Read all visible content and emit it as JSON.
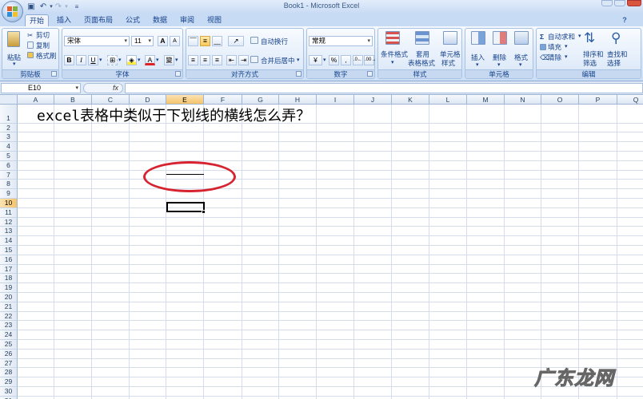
{
  "window": {
    "title": "Book1 - Microsoft Excel"
  },
  "colors": {
    "accent": "#15428b",
    "selected_header": "#f5c36b",
    "annotation": "#d7232f"
  },
  "tabs": [
    "开始",
    "插入",
    "页面布局",
    "公式",
    "数据",
    "审阅",
    "视图"
  ],
  "ribbon": {
    "clipboard": {
      "paste": "粘贴",
      "cut": "剪切",
      "copy": "复制",
      "format_painter": "格式刷",
      "label": "剪贴板"
    },
    "font": {
      "name": "宋体",
      "size": "11",
      "grow": "A",
      "shrink": "A",
      "bold": "B",
      "italic": "I",
      "underline": "U",
      "color": "A",
      "wen": "變",
      "label": "字体"
    },
    "alignment": {
      "wrap": "自动换行",
      "merge": "合并后居中",
      "label": "对齐方式"
    },
    "number": {
      "format": "常规",
      "percent": "%",
      "comma": ",",
      "label": "数字"
    },
    "styles": {
      "conditional": "条件格式",
      "table": [
        "套用",
        "表格格式"
      ],
      "cell": [
        "单元格",
        "样式"
      ],
      "label": "样式"
    },
    "cells": {
      "insert": "插入",
      "delete": "删除",
      "format": "格式",
      "label": "单元格"
    },
    "editing": {
      "autosum": "自动求和",
      "fill": "填充",
      "clear": "清除",
      "sort": [
        "排序和",
        "筛选"
      ],
      "find": [
        "查找和",
        "选择"
      ],
      "label": "编辑"
    }
  },
  "formula_bar": {
    "name_box": "E10",
    "fx": "fx",
    "value": ""
  },
  "grid": {
    "columns": [
      "A",
      "B",
      "C",
      "D",
      "E",
      "F",
      "G",
      "H",
      "I",
      "J",
      "K",
      "L",
      "M",
      "N",
      "O",
      "P",
      "Q"
    ],
    "rows": [
      "1",
      "2",
      "3",
      "4",
      "5",
      "6",
      "7",
      "8",
      "9",
      "10",
      "11",
      "12",
      "13",
      "14",
      "15",
      "16",
      "17",
      "18",
      "19",
      "20",
      "21",
      "22",
      "23",
      "24",
      "25",
      "26",
      "27",
      "28",
      "29",
      "30",
      "31"
    ],
    "selected_cell": "E10",
    "cells": {
      "A1": "excel表格中类似于下划线的横线怎么弄？"
    }
  },
  "watermark": "广东龙网"
}
